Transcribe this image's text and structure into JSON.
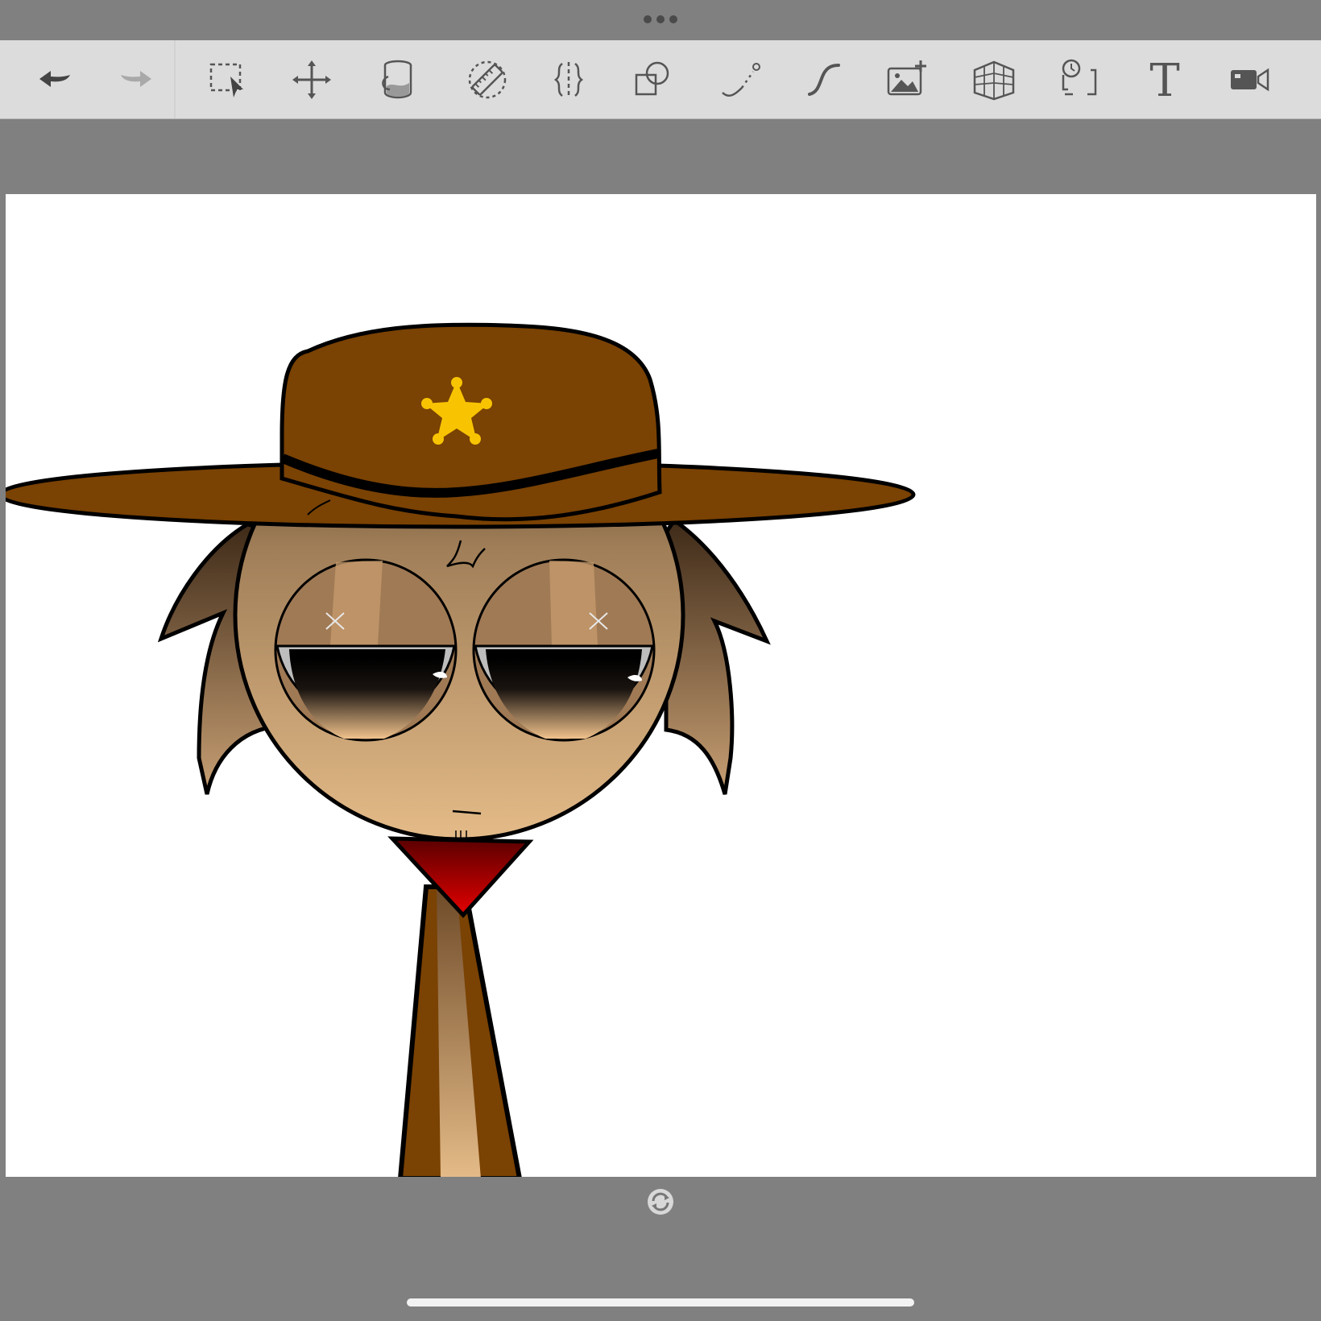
{
  "window": {
    "menu_icon": "more-dots-icon"
  },
  "toolbar": {
    "tools": [
      {
        "name": "undo",
        "icon": "undo-arrow-icon"
      },
      {
        "name": "redo",
        "icon": "redo-arrow-icon"
      },
      {
        "name": "selection",
        "icon": "selection-icon"
      },
      {
        "name": "move",
        "icon": "move-arrows-icon"
      },
      {
        "name": "fill",
        "icon": "paint-bucket-icon"
      },
      {
        "name": "ruler",
        "icon": "ruler-icon"
      },
      {
        "name": "symmetry",
        "icon": "symmetry-icon"
      },
      {
        "name": "shapes",
        "icon": "shapes-icon"
      },
      {
        "name": "curve",
        "icon": "curve-icon"
      },
      {
        "name": "stroke",
        "icon": "stroke-icon"
      },
      {
        "name": "import-image",
        "icon": "add-image-icon"
      },
      {
        "name": "perspective",
        "icon": "perspective-grid-icon"
      },
      {
        "name": "time-lapse",
        "icon": "time-lapse-icon"
      },
      {
        "name": "text",
        "icon": "text-icon",
        "label": "T"
      },
      {
        "name": "record",
        "icon": "video-camera-icon"
      }
    ],
    "colors": {
      "background": "#dcdcdc",
      "icon": "#555555",
      "disabled": "#a9a9a9"
    }
  },
  "canvas": {
    "background": "#ffffff",
    "artwork": "cowboy-character-drawing",
    "colors": {
      "hat": "#7a4203",
      "badge": "#f8c401",
      "skin": "#e0b887",
      "bandana": "#c40000"
    }
  },
  "rotate_handle": {
    "icon": "rotate-icon"
  },
  "workspace": {
    "background": "#808080"
  }
}
